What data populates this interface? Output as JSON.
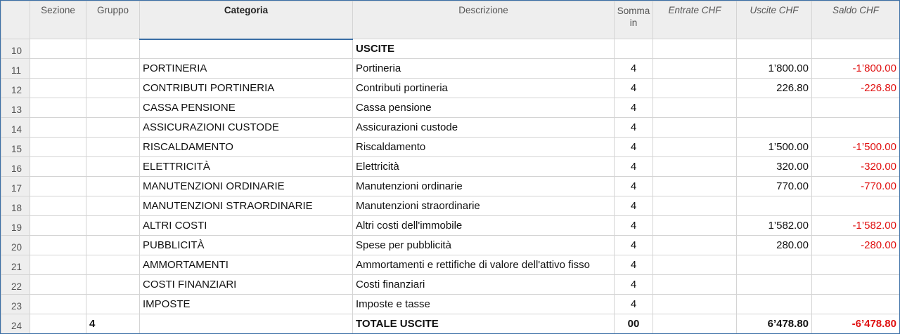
{
  "columns": {
    "sezione": "Sezione",
    "gruppo": "Gruppo",
    "categoria": "Categoria",
    "descrizione": "Descrizione",
    "somma_in": "Somma in",
    "entrate": "Entrate CHF",
    "uscite": "Uscite CHF",
    "saldo": "Saldo CHF"
  },
  "rows": [
    {
      "n": "10",
      "sezione": "",
      "gruppo": "",
      "categoria": "",
      "descrizione": "USCITE",
      "somma_in": "",
      "entrate": "",
      "uscite": "",
      "saldo": ""
    },
    {
      "n": "11",
      "sezione": "",
      "gruppo": "",
      "categoria": "PORTINERIA",
      "descrizione": "Portineria",
      "somma_in": "4",
      "entrate": "",
      "uscite": "1’800.00",
      "saldo": "-1’800.00"
    },
    {
      "n": "12",
      "sezione": "",
      "gruppo": "",
      "categoria": "CONTRIBUTI PORTINERIA",
      "descrizione": "Contributi portineria",
      "somma_in": "4",
      "entrate": "",
      "uscite": "226.80",
      "saldo": "-226.80"
    },
    {
      "n": "13",
      "sezione": "",
      "gruppo": "",
      "categoria": "CASSA PENSIONE",
      "descrizione": "Cassa pensione",
      "somma_in": "4",
      "entrate": "",
      "uscite": "",
      "saldo": ""
    },
    {
      "n": "14",
      "sezione": "",
      "gruppo": "",
      "categoria": "ASSICURAZIONI CUSTODE",
      "descrizione": "Assicurazioni custode",
      "somma_in": "4",
      "entrate": "",
      "uscite": "",
      "saldo": ""
    },
    {
      "n": "15",
      "sezione": "",
      "gruppo": "",
      "categoria": "RISCALDAMENTO",
      "descrizione": "Riscaldamento",
      "somma_in": "4",
      "entrate": "",
      "uscite": "1’500.00",
      "saldo": "-1’500.00"
    },
    {
      "n": "16",
      "sezione": "",
      "gruppo": "",
      "categoria": "ELETTRICITÀ",
      "descrizione": "Elettricità",
      "somma_in": "4",
      "entrate": "",
      "uscite": "320.00",
      "saldo": "-320.00"
    },
    {
      "n": "17",
      "sezione": "",
      "gruppo": "",
      "categoria": "MANUTENZIONI ORDINARIE",
      "descrizione": "Manutenzioni ordinarie",
      "somma_in": "4",
      "entrate": "",
      "uscite": "770.00",
      "saldo": "-770.00"
    },
    {
      "n": "18",
      "sezione": "",
      "gruppo": "",
      "categoria": "MANUTENZIONI STRAORDINARIE",
      "descrizione": "Manutenzioni straordinarie",
      "somma_in": "4",
      "entrate": "",
      "uscite": "",
      "saldo": ""
    },
    {
      "n": "19",
      "sezione": "",
      "gruppo": "",
      "categoria": "ALTRI COSTI",
      "descrizione": "Altri costi dell'immobile",
      "somma_in": "4",
      "entrate": "",
      "uscite": "1’582.00",
      "saldo": "-1’582.00"
    },
    {
      "n": "20",
      "sezione": "",
      "gruppo": "",
      "categoria": "PUBBLICITÀ",
      "descrizione": "Spese per pubblicità",
      "somma_in": "4",
      "entrate": "",
      "uscite": "280.00",
      "saldo": "-280.00"
    },
    {
      "n": "21",
      "sezione": "",
      "gruppo": "",
      "categoria": "AMMORTAMENTI",
      "descrizione": "Ammortamenti e rettifiche di valore dell'attivo fisso",
      "somma_in": "4",
      "entrate": "",
      "uscite": "",
      "saldo": ""
    },
    {
      "n": "22",
      "sezione": "",
      "gruppo": "",
      "categoria": "COSTI FINANZIARI",
      "descrizione": "Costi finanziari",
      "somma_in": "4",
      "entrate": "",
      "uscite": "",
      "saldo": ""
    },
    {
      "n": "23",
      "sezione": "",
      "gruppo": "",
      "categoria": "IMPOSTE",
      "descrizione": "Imposte e tasse",
      "somma_in": "4",
      "entrate": "",
      "uscite": "",
      "saldo": ""
    },
    {
      "n": "24",
      "sezione": "",
      "gruppo": "4",
      "categoria": "",
      "descrizione": "TOTALE USCITE",
      "somma_in": "00",
      "entrate": "",
      "uscite": "6’478.80",
      "saldo": "-6’478.80"
    }
  ],
  "bold_rows": [
    "10",
    "24"
  ],
  "colors": {
    "negative": "#e01010",
    "header_bg": "#eeeeee",
    "accent": "#3a6ea5"
  }
}
